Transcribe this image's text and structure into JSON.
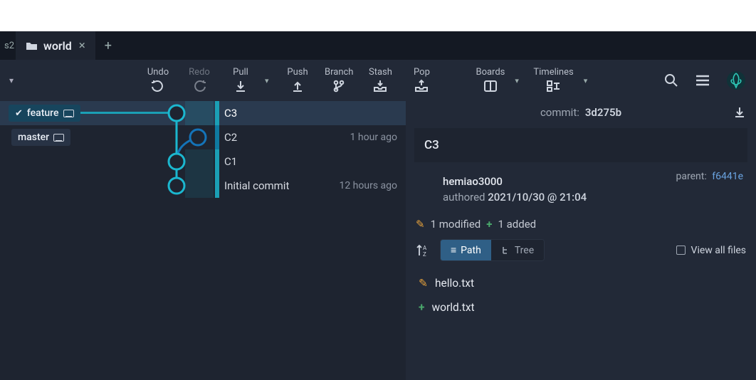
{
  "tabs": {
    "prev_stub": "s2",
    "active": {
      "icon": "folder-icon",
      "label": "world"
    }
  },
  "toolbar": {
    "undo": "Undo",
    "redo": "Redo",
    "pull": "Pull",
    "push": "Push",
    "branch": "Branch",
    "stash": "Stash",
    "pop": "Pop",
    "boards": "Boards",
    "timelines": "Timelines"
  },
  "graph": {
    "refs": {
      "feature": "feature",
      "master": "master"
    },
    "commits": [
      {
        "msg": "C3",
        "time": ""
      },
      {
        "msg": "C2",
        "time": "1 hour ago"
      },
      {
        "msg": "C1",
        "time": ""
      },
      {
        "msg": "Initial commit",
        "time": "12 hours ago"
      }
    ]
  },
  "detail": {
    "head_label": "commit:",
    "hash": "3d275b",
    "message": "C3",
    "author": "hemiao3000",
    "auth_prefix": "authored",
    "auth_time": "2021/10/30 @ 21:04",
    "parent_label": "parent:",
    "parent_hash": "f6441e",
    "stats": {
      "modified": "1 modified",
      "added": "1 added"
    },
    "view_path": "Path",
    "view_tree": "Tree",
    "view_all": "View all files",
    "files": [
      {
        "kind": "modified",
        "name": "hello.txt"
      },
      {
        "kind": "added",
        "name": "world.txt"
      }
    ]
  }
}
